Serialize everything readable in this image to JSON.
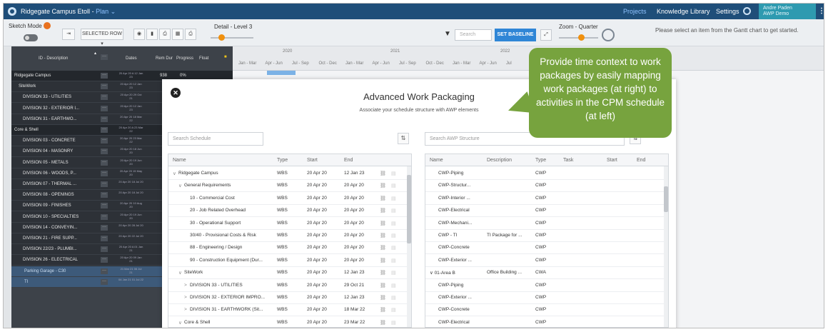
{
  "app": {
    "title": "Ridgegate Campus Etoll",
    "view": "Plan",
    "nav": [
      "Projects",
      "Knowledge Library",
      "Settings"
    ],
    "user_line1": "Andre Paden",
    "user_line2": "AWP Demo"
  },
  "toolbar": {
    "sketch_mode": "Sketch Mode",
    "selected_row": "SELECTED ROW",
    "detail_label": "Detail - Level 3",
    "search_placeholder": "Search",
    "set_baseline": "SET BASELINE",
    "zoom_label": "Zoom - Quarter",
    "hint": "Please select an item from the Gantt chart to get started."
  },
  "gantt": {
    "headers": {
      "id": "ID - Description",
      "dates": "Dates",
      "rem_dur": "Rem Dur",
      "progress": "Progress",
      "float": "Float"
    },
    "years": [
      "2020",
      "2021",
      "2022"
    ],
    "quarters": [
      "Jan - Mar",
      "Apr - Jun",
      "Jul - Sep",
      "Oct - Dec",
      "Jan - Mar",
      "Apr - Jun",
      "Jul - Sep",
      "Oct - Dec",
      "Jan - Mar",
      "Apr - Jun",
      "Jul"
    ],
    "rows": [
      {
        "label": "Ridgegate Campus",
        "dates": "20 Apr 20 A 12 Jan 23",
        "rem": "938",
        "prog": "0%"
      },
      {
        "label": "SiteWork",
        "dates": "20 Apr 20 12 Jan 23"
      },
      {
        "label": "DIVISION 33 - UTILITIES",
        "dates": "20 Apr 20 29 Oct 21"
      },
      {
        "label": "DIVISION 32 - EXTERIOR I...",
        "dates": "20 Apr 20 12 Jan 23"
      },
      {
        "label": "DIVISION 31 - EARTHWO...",
        "dates": "20 Apr 20 18 Mar 22"
      },
      {
        "label": "Core & Shell",
        "dates": "20 Apr 20 A 23 Mar 22"
      },
      {
        "label": "DIVISION 03 - CONCRETE",
        "dates": "20 Apr 20 23 Mar 22"
      },
      {
        "label": "DIVISION 04 - MASONRY",
        "dates": "20 Apr 20 18 Jun 20"
      },
      {
        "label": "DIVISION 05 - METALS",
        "dates": "20 Apr 20 19 Jun 20"
      },
      {
        "label": "DIVISION 06 - WOODS, P...",
        "dates": "20 Apr 20 15 May 20"
      },
      {
        "label": "DIVISION 07 - THERMAL ...",
        "dates": "20 Apr 20 18 Jul 20"
      },
      {
        "label": "DIVISION 08 - OPENINGS",
        "dates": "20 Apr 20 18 Jul 20"
      },
      {
        "label": "DIVISION 09 - FINISHES",
        "dates": "20 Apr 20 10 Aug 20"
      },
      {
        "label": "DIVISION 10 - SPECIALTIES",
        "dates": "20 Apr 20 19 Jun 20"
      },
      {
        "label": "DIVISION 14 - CONVEYIN...",
        "dates": "20 Apr 20 28 Jul 20"
      },
      {
        "label": "DIVISION 21 - FIRE SUPP...",
        "dates": "20 Apr 20 22 Jul 20"
      },
      {
        "label": "DIVISION 22/23 - PLUMBI...",
        "dates": "20 Apr 20 A 01 Jan 21"
      },
      {
        "label": "DIVISION 26 - ELECTRICAL",
        "dates": "20 Apr 20 09 Jan 21"
      },
      {
        "label": "Parking Garage - C30",
        "dates": "21 Mar 21 06 Jul 21"
      },
      {
        "label": "TI",
        "dates": "04 Jan 21 01 Jul 22"
      }
    ]
  },
  "modal": {
    "title": "Advanced Work Packaging",
    "subtitle": "Associate your schedule structure with AWP elements",
    "search_schedule": "Search Schedule",
    "search_awp": "Search AWP Structure",
    "left_headers": [
      "Name",
      "Type",
      "Start",
      "End"
    ],
    "left_rows": [
      {
        "chev": "∨",
        "name": "Ridgegate Campus",
        "type": "WBS",
        "start": "20 Apr 20",
        "end": "12 Jan 23",
        "indent": 0
      },
      {
        "chev": "∨",
        "name": "General Requirements",
        "type": "WBS",
        "start": "20 Apr 20",
        "end": "20 Apr 20",
        "indent": 1
      },
      {
        "chev": "",
        "name": "10 - Commercial Cost",
        "type": "WBS",
        "start": "20 Apr 20",
        "end": "20 Apr 20",
        "indent": 2
      },
      {
        "chev": "",
        "name": "20 - Job Related Overhead",
        "type": "WBS",
        "start": "20 Apr 20",
        "end": "20 Apr 20",
        "indent": 2
      },
      {
        "chev": "",
        "name": "30 - Operational Support",
        "type": "WBS",
        "start": "20 Apr 20",
        "end": "20 Apr 20",
        "indent": 2
      },
      {
        "chev": "",
        "name": "30/40 - Provisional Costs & Risk",
        "type": "WBS",
        "start": "20 Apr 20",
        "end": "20 Apr 20",
        "indent": 2
      },
      {
        "chev": "",
        "name": "88 - Engineering / Design",
        "type": "WBS",
        "start": "20 Apr 20",
        "end": "20 Apr 20",
        "indent": 2
      },
      {
        "chev": "",
        "name": "90 - Construction Equipment (Dur...",
        "type": "WBS",
        "start": "20 Apr 20",
        "end": "20 Apr 20",
        "indent": 2
      },
      {
        "chev": "∨",
        "name": "SiteWork",
        "type": "WBS",
        "start": "20 Apr 20",
        "end": "12 Jan 23",
        "indent": 1
      },
      {
        "chev": ">",
        "name": "DIVISION 33 - UTILITIES",
        "type": "WBS",
        "start": "20 Apr 20",
        "end": "29 Oct 21",
        "indent": 2
      },
      {
        "chev": ">",
        "name": "DIVISION 32 - EXTERIOR IMPRO...",
        "type": "WBS",
        "start": "20 Apr 20",
        "end": "12 Jan 23",
        "indent": 2
      },
      {
        "chev": ">",
        "name": "DIVISION 31 - EARTHWORK (Sit...",
        "type": "WBS",
        "start": "20 Apr 20",
        "end": "18 Mar 22",
        "indent": 2
      },
      {
        "chev": "∨",
        "name": "Core & Shell",
        "type": "WBS",
        "start": "20 Apr 20",
        "end": "23 Mar 22",
        "indent": 1
      }
    ],
    "right_headers": [
      "Name",
      "Description",
      "Type",
      "Task",
      "Start",
      "End"
    ],
    "right_rows": [
      {
        "name": "CWP-Piping",
        "desc": "",
        "type": "CWP"
      },
      {
        "name": "CWP-Structur...",
        "desc": "",
        "type": "CWP"
      },
      {
        "name": "CWP-Interior ...",
        "desc": "",
        "type": "CWP"
      },
      {
        "name": "CWP-Electrical",
        "desc": "",
        "type": "CWP"
      },
      {
        "name": "CWP-Mechani...",
        "desc": "",
        "type": "CWP"
      },
      {
        "name": "CWP - TI",
        "desc": "TI Package for ...",
        "type": "CWP"
      },
      {
        "name": "CWP-Concrete",
        "desc": "",
        "type": "CWP"
      },
      {
        "name": "CWP-Exterior ...",
        "desc": "",
        "type": "CWP"
      },
      {
        "name": "∨ 01-Area B",
        "desc": "Office Building ...",
        "type": "CWA"
      },
      {
        "name": "CWP-Piping",
        "desc": "",
        "type": "CWP"
      },
      {
        "name": "CWP-Exterior ...",
        "desc": "",
        "type": "CWP"
      },
      {
        "name": "CWP-Concrete",
        "desc": "",
        "type": "CWP"
      },
      {
        "name": "CWP-Electrical",
        "desc": "",
        "type": "CWP"
      }
    ]
  },
  "callout": {
    "text": "Provide time context to work packages by easily mapping work packages (at right) to activities in the CPM schedule (at left)"
  },
  "colors": {
    "topbar": "#1f4e79",
    "accent_blue": "#2f86d6",
    "orange": "#f0900e",
    "callout_green": "#77a33e"
  }
}
